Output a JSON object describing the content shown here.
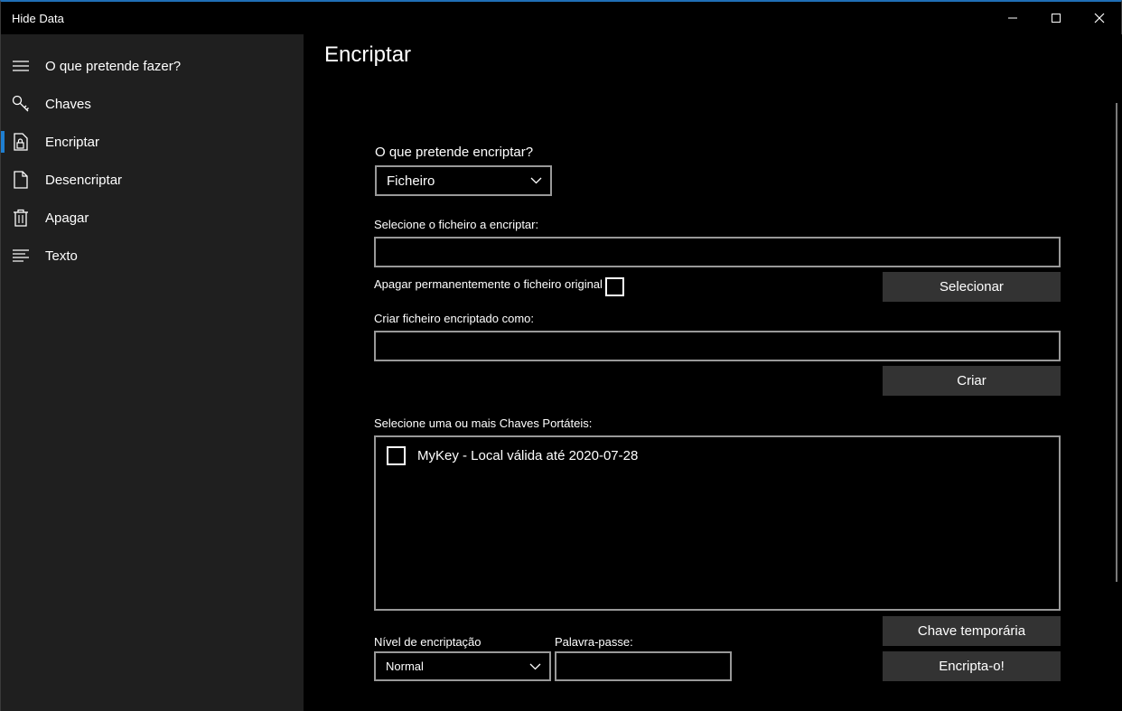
{
  "window": {
    "title": "Hide Data",
    "controls": [
      "minimize-icon",
      "maximize-icon",
      "close-icon"
    ]
  },
  "sidebar": {
    "items": [
      {
        "label": "O que pretende fazer?",
        "icon": "hamburger-menu-icon",
        "selected": false
      },
      {
        "label": "Chaves",
        "icon": "key-icon",
        "selected": false
      },
      {
        "label": "Encriptar",
        "icon": "lock-document-icon",
        "selected": true
      },
      {
        "label": "Desencriptar",
        "icon": "document-icon",
        "selected": false
      },
      {
        "label": "Apagar",
        "icon": "trash-icon",
        "selected": false
      },
      {
        "label": "Texto",
        "icon": "text-lines-icon",
        "selected": false
      }
    ]
  },
  "main": {
    "title": "Encriptar",
    "what_label": "O que pretende encriptar?",
    "what_selected": "Ficheiro",
    "select_file_label": "Selecione o ficheiro a encriptar:",
    "select_file_value": "",
    "delete_original_label": "Apagar permanentemente o ficheiro original",
    "delete_original_checked": false,
    "select_button": "Selecionar",
    "create_as_label": "Criar ficheiro encriptado como:",
    "create_as_value": "",
    "create_button": "Criar",
    "keys_label": "Selecione uma ou mais Chaves Portáteis:",
    "keys": [
      {
        "label": "MyKey - Local válida até 2020-07-28",
        "checked": false
      }
    ],
    "level_label": "Nível de encriptação",
    "level_selected": "Normal",
    "password_label": "Palavra-passe:",
    "password_value": "",
    "temp_key_button": "Chave temporária",
    "encrypt_button": "Encripta-o!"
  },
  "colors": {
    "accent": "#1f7fd1",
    "sidebar_bg": "#1f1f1f",
    "button_bg": "#333333",
    "border": "#999999"
  }
}
